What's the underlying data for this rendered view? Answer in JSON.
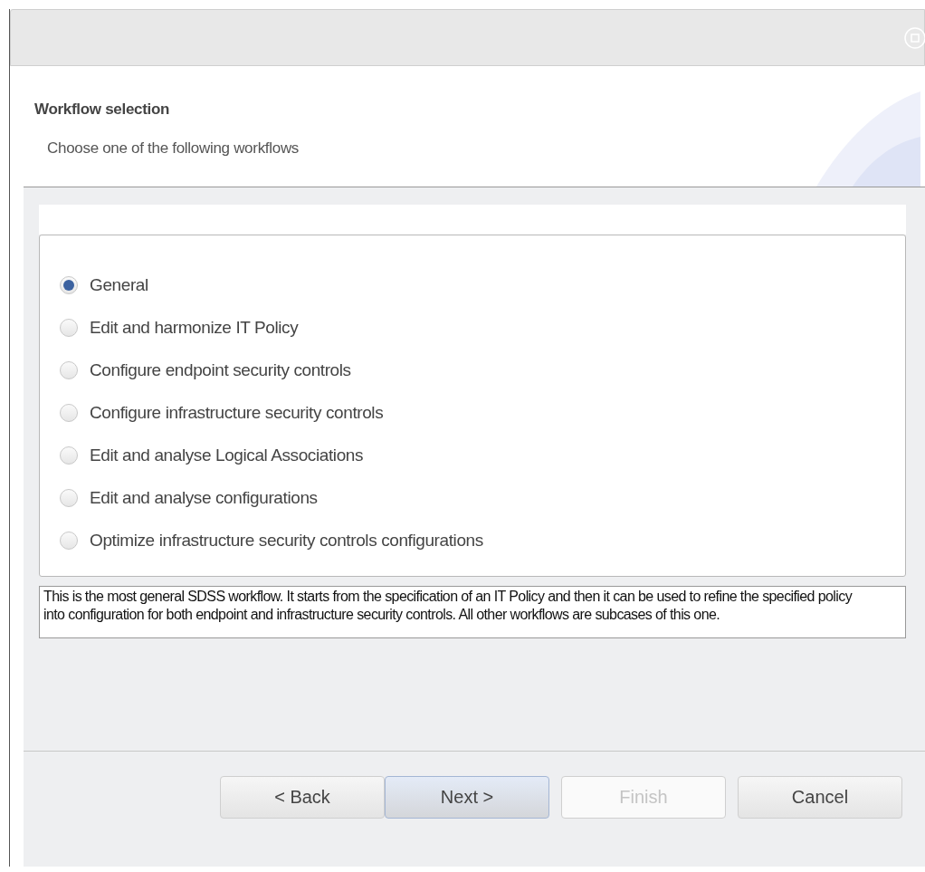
{
  "header": {
    "title": "Workflow selection",
    "subtitle": "Choose one of the following workflows"
  },
  "workflows": [
    {
      "label": "General",
      "selected": true
    },
    {
      "label": "Edit and harmonize IT Policy",
      "selected": false
    },
    {
      "label": "Configure endpoint security controls",
      "selected": false
    },
    {
      "label": "Configure infrastructure security controls",
      "selected": false
    },
    {
      "label": "Edit and analyse Logical Associations",
      "selected": false
    },
    {
      "label": "Edit and analyse configurations",
      "selected": false
    },
    {
      "label": "Optimize infrastructure security controls configurations",
      "selected": false
    }
  ],
  "description": "This is the most general SDSS workflow. It starts from the specification of an IT Policy and then it can be used to refine the specified policy into configuration for both endpoint and infrastructure security controls. All other workflows are subcases of this one.",
  "buttons": [
    {
      "label": "< Back",
      "default": false,
      "disabled": false
    },
    {
      "label": "Next >",
      "default": true,
      "disabled": false
    },
    {
      "label": "Finish",
      "default": false,
      "disabled": true
    },
    {
      "label": "Cancel",
      "default": false,
      "disabled": false
    }
  ]
}
